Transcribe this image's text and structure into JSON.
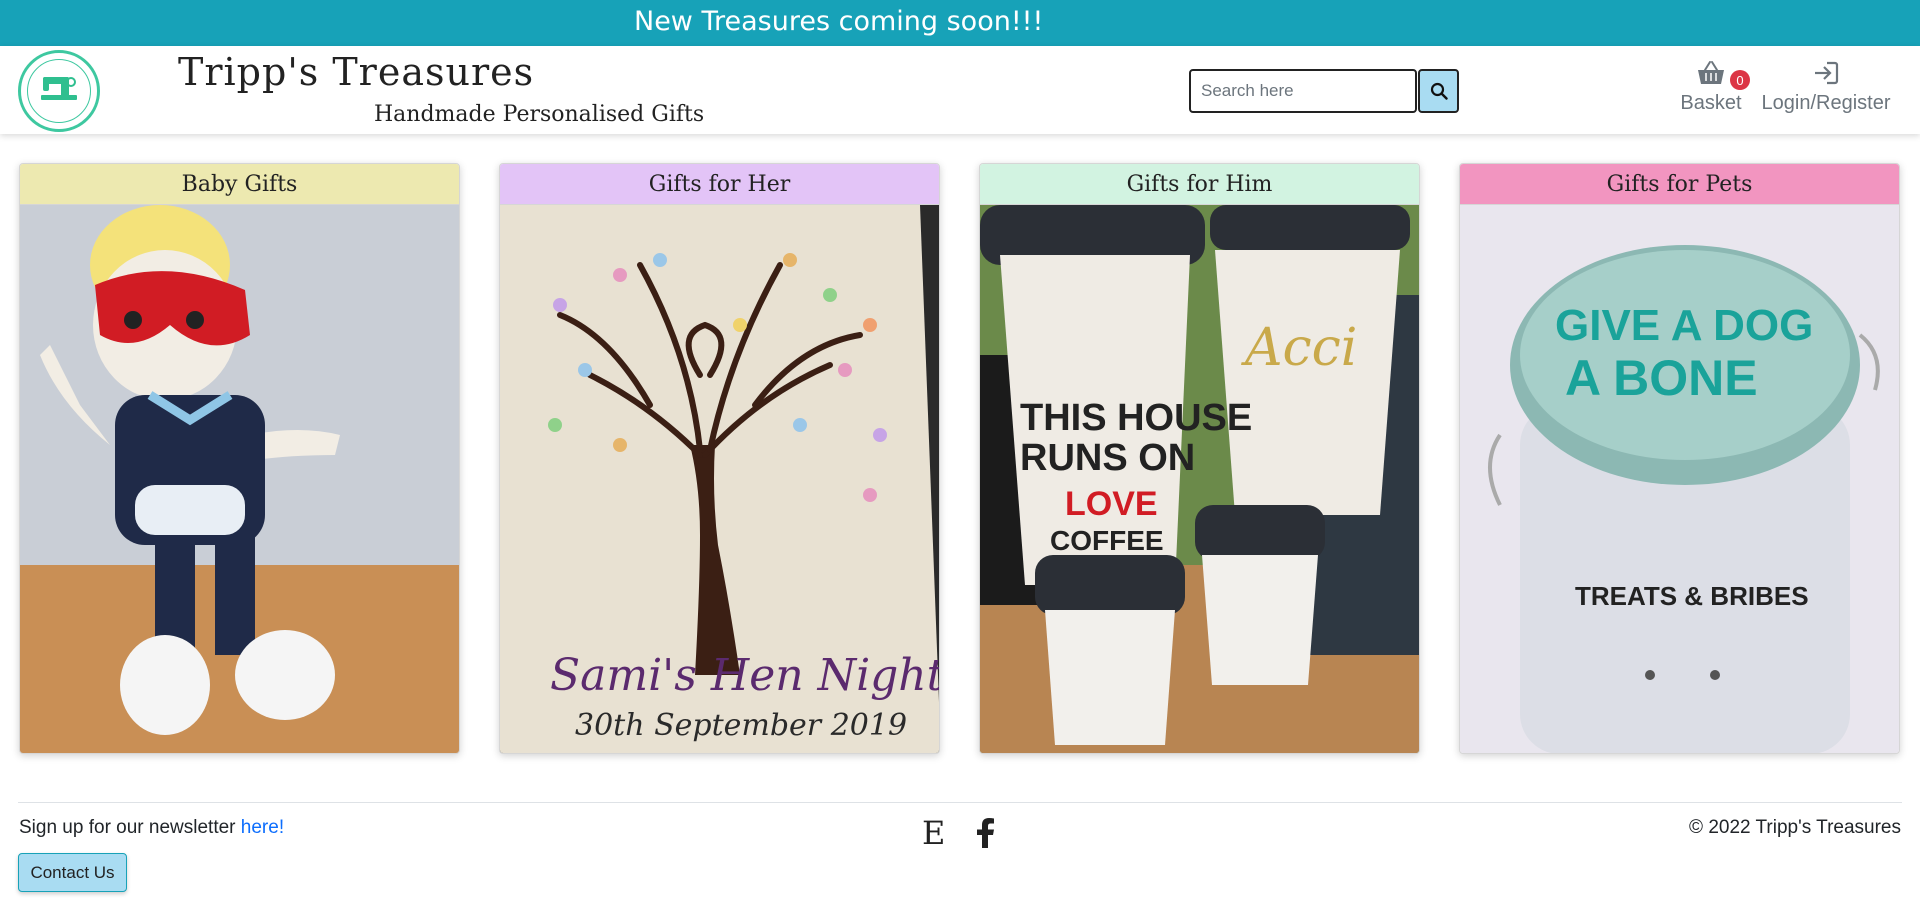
{
  "announcement": {
    "text": "New Treasures coming soon!!!"
  },
  "header": {
    "brand_title": "Tripp's Treasures",
    "brand_subtitle": "Handmade Personalised Gifts",
    "logo_icon": "sewing-machine-logo",
    "search": {
      "placeholder": "Search here",
      "value": "",
      "button_icon": "search-icon"
    },
    "basket": {
      "label": "Basket",
      "count": "0",
      "icon": "basket-icon"
    },
    "login": {
      "label": "Login/Register",
      "icon": "login-icon"
    }
  },
  "categories": [
    {
      "title": "Baby Gifts",
      "header_color": "#ede9b0",
      "image": "superhero-doll-photo"
    },
    {
      "title": "Gifts for Her",
      "header_color": "#e3c4f7",
      "image": "fingerprint-tree-canvas-photo",
      "image_text": [
        "Sami's Hen Night",
        "30th September 2019"
      ]
    },
    {
      "title": "Gifts for Him",
      "header_color": "#d2f3e1",
      "image": "coffee-cups-photo",
      "image_text": [
        "THIS HOUSE RUNS ON",
        "LOVE",
        "COFFEE"
      ]
    },
    {
      "title": "Gifts for Pets",
      "header_color": "#f295c0",
      "image": "dog-treat-jar-photo",
      "image_text": [
        "GIVE A DOG A BONE",
        "TREATS & BRIBES"
      ]
    }
  ],
  "footer": {
    "newsletter_text": "Sign up for our newsletter",
    "newsletter_link": "here!",
    "contact_button": "Contact Us",
    "social": {
      "etsy_glyph": "E",
      "etsy_icon": "etsy-icon",
      "facebook_icon": "facebook-icon"
    },
    "copyright": "© 2022 Tripp's Treasures"
  },
  "colors": {
    "banner": "#17a2b8",
    "button_fill": "#a9dcf2",
    "badge": "#dc3545",
    "link": "#0d6efd"
  }
}
